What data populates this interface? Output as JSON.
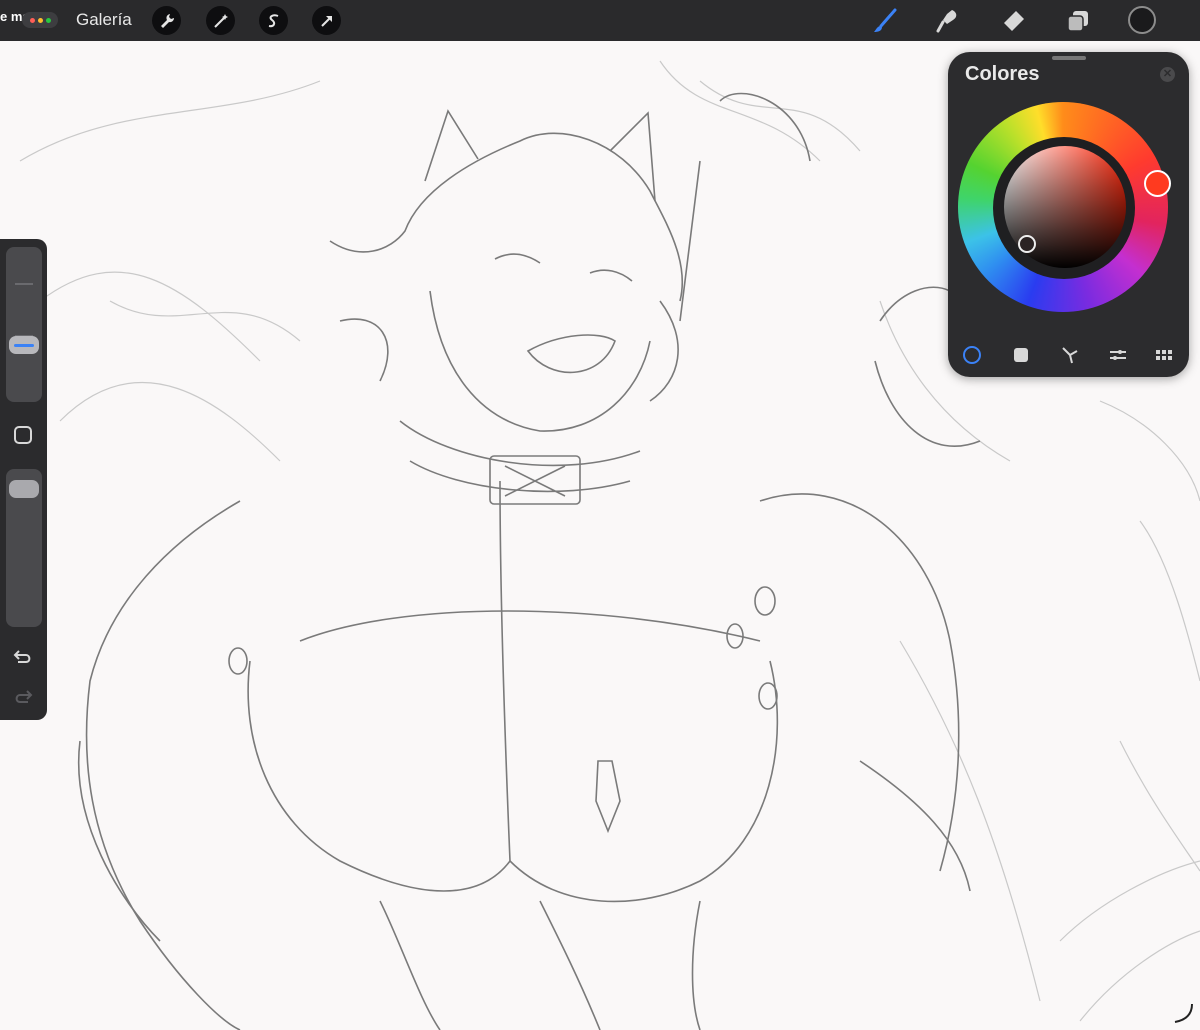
{
  "status": {
    "time_fragment": "e mar"
  },
  "toolbar": {
    "gallery_label": "Galería",
    "left_tools": [
      "wrench-icon",
      "magic-wand-icon",
      "selection-icon",
      "transform-arrow-icon"
    ],
    "right_tools": [
      "brush-icon",
      "smudge-icon",
      "eraser-icon",
      "layers-icon"
    ],
    "current_color": "#1a1a1c"
  },
  "sidebar": {
    "brush_size_level": 0.62,
    "opacity_level": 0.93,
    "icons": [
      "modify-square-icon",
      "undo-icon",
      "redo-icon"
    ]
  },
  "colors_panel": {
    "title": "Colores",
    "close_icon": "close-icon",
    "hue_color": "#ff3a1f",
    "selected_color": "#2b2323",
    "tabs": [
      "disc-icon",
      "classic-icon",
      "harmony-icon",
      "value-icon",
      "palettes-icon"
    ],
    "active_tab": 0,
    "accent": "#3b82f6"
  }
}
